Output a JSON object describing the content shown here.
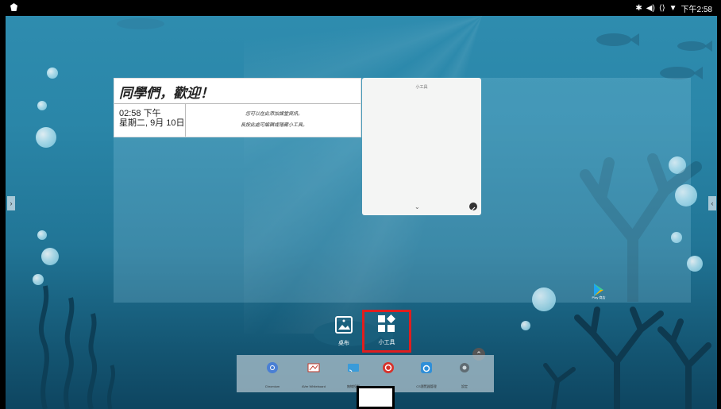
{
  "status_bar": {
    "time": "下午2:58",
    "icons": [
      "bluetooth-icon",
      "volume-icon",
      "ethernet-icon",
      "wifi-icon"
    ]
  },
  "greeting_widget": {
    "title": "同學們，歡迎！",
    "time": "02:58 下午",
    "date": "星期二, 9月 10日",
    "info_line1": "您可以在此添加課堂資訊。",
    "info_line2": "長按此處可編輯或隱藏小工具。"
  },
  "widget_panel": {
    "title": "小工具"
  },
  "play_store": {
    "label": "Play 商店"
  },
  "home_options": [
    {
      "label": "桌布",
      "icon": "wallpaper-icon"
    },
    {
      "label": "小工具",
      "icon": "widgets-icon"
    }
  ],
  "dock": {
    "items": [
      {
        "label": "Chromium",
        "icon": "chromium-icon"
      },
      {
        "label": "AVer Whiteboard",
        "icon": "whiteboard-icon"
      },
      {
        "label": "無線投影",
        "icon": "cast-icon"
      },
      {
        "label": "",
        "icon": "app-icon"
      },
      {
        "label": "CS瀏覽器管理",
        "icon": "browser-icon"
      },
      {
        "label": "設定",
        "icon": "settings-icon"
      }
    ]
  },
  "colors": {
    "highlight": "#e01e1e",
    "ocean_top": "#2f8db0",
    "ocean_bottom": "#0e4560"
  }
}
